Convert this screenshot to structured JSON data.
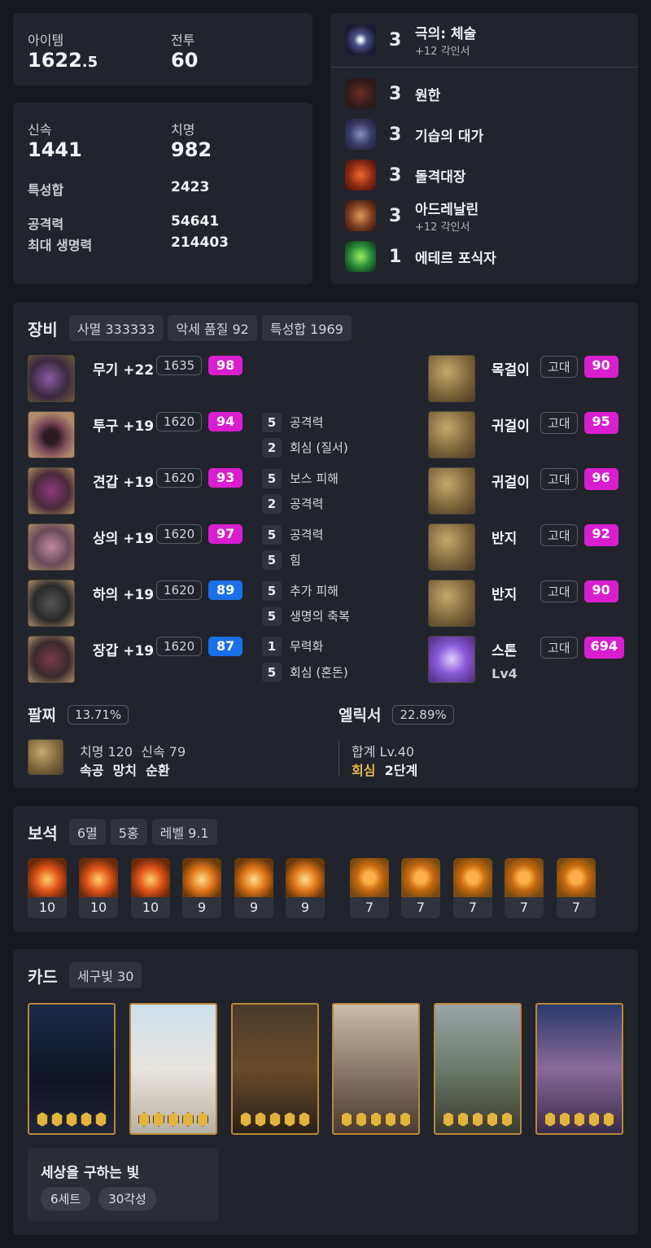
{
  "stats1": {
    "item_label": "아이템",
    "item_value_main": "1622",
    "item_value_frac": ".5",
    "combat_label": "전투",
    "combat_value": "60"
  },
  "stats2": {
    "swift_label": "신속",
    "swift_value": "1441",
    "crit_label": "치명",
    "crit_value": "982",
    "total_label": "특성합",
    "total_value": "2423",
    "atk_label": "공격력",
    "atk_value": "54641",
    "hp_label": "최대 생명력",
    "hp_value": "214403"
  },
  "engravings": [
    {
      "level": "3",
      "name": "극의: 체술",
      "sub": "+12 각인서"
    },
    {
      "level": "3",
      "name": "원한",
      "sub": ""
    },
    {
      "level": "3",
      "name": "기습의 대가",
      "sub": ""
    },
    {
      "level": "3",
      "name": "돌격대장",
      "sub": ""
    },
    {
      "level": "3",
      "name": "아드레날린",
      "sub": "+12 각인서"
    },
    {
      "level": "1",
      "name": "에테르 포식자",
      "sub": ""
    }
  ],
  "equipment": {
    "title": "장비",
    "chips": [
      "사멸 333333",
      "악세 품질 92",
      "특성합 1969"
    ],
    "armor": [
      {
        "name": "무기 +22",
        "ilvl": "1635",
        "quality": "98",
        "color": "#d81ecf"
      },
      {
        "name": "투구 +19",
        "ilvl": "1620",
        "quality": "94",
        "color": "#d81ecf"
      },
      {
        "name": "견갑 +19",
        "ilvl": "1620",
        "quality": "93",
        "color": "#d81ecf"
      },
      {
        "name": "상의 +19",
        "ilvl": "1620",
        "quality": "97",
        "color": "#d81ecf"
      },
      {
        "name": "하의 +19",
        "ilvl": "1620",
        "quality": "89",
        "color": "#1b6fe8"
      },
      {
        "name": "장갑 +19",
        "ilvl": "1620",
        "quality": "87",
        "color": "#1b6fe8"
      }
    ],
    "effects": [
      {
        "n": "5",
        "t": "공격력"
      },
      {
        "n": "2",
        "t": "회심 (질서)"
      },
      {
        "n": "5",
        "t": "보스 피해"
      },
      {
        "n": "2",
        "t": "공격력"
      },
      {
        "n": "5",
        "t": "공격력"
      },
      {
        "n": "5",
        "t": "힘"
      },
      {
        "n": "5",
        "t": "추가 피해"
      },
      {
        "n": "5",
        "t": "생명의 축복"
      },
      {
        "n": "1",
        "t": "무력화"
      },
      {
        "n": "5",
        "t": "회심 (혼돈)"
      }
    ],
    "acc": [
      {
        "name": "목걸이",
        "grade": "고대",
        "quality": "90"
      },
      {
        "name": "귀걸이",
        "grade": "고대",
        "quality": "95"
      },
      {
        "name": "귀걸이",
        "grade": "고대",
        "quality": "96"
      },
      {
        "name": "반지",
        "grade": "고대",
        "quality": "92"
      },
      {
        "name": "반지",
        "grade": "고대",
        "quality": "90"
      },
      {
        "name": "스톤",
        "grade": "고대",
        "quality": "694",
        "extra": "Lv4"
      }
    ],
    "bracelet": {
      "title": "팔찌",
      "pct": "13.71%",
      "line1": "치명 120  신속 79",
      "line2": "속공  망치  순환"
    },
    "elixir": {
      "title": "엘릭서",
      "pct": "22.89%",
      "line1": "합계 Lv.40",
      "line2a": "회심",
      "line2b": "2단계"
    }
  },
  "gems": {
    "title": "보석",
    "chips": [
      "6멸",
      "5홍",
      "레벨 9.1"
    ],
    "levels": [
      "10",
      "10",
      "10",
      "9",
      "9",
      "9",
      "7",
      "7",
      "7",
      "7",
      "7"
    ]
  },
  "cards": {
    "title": "카드",
    "chip": "세구빛 30",
    "set_name": "세상을 구하는 빛",
    "set_chips": [
      "6세트",
      "30각성"
    ]
  },
  "colors": {
    "bg": "#16181e",
    "panel": "#21242c",
    "magenta": "#d81ecf",
    "blue": "#1b6fe8",
    "gold": "#e2b33e"
  }
}
